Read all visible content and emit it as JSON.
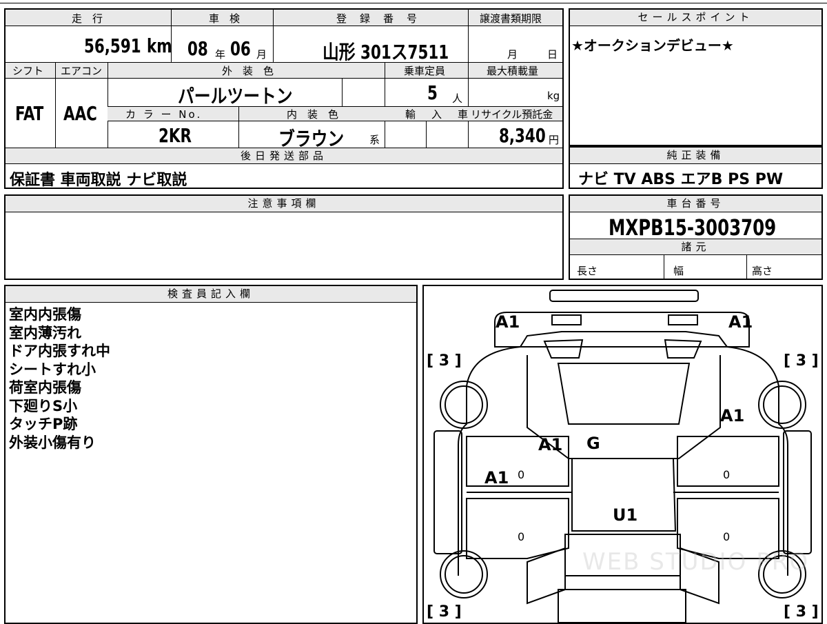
{
  "vehicle": {
    "mileage_label": "走　行",
    "mileage": "56,591",
    "mileage_unit": "km",
    "shaken_label": "車　検",
    "shaken_year": "08",
    "shaken_year_unit": "年",
    "shaken_month": "06",
    "shaken_month_unit": "月",
    "reg_label": "登　録　番　号",
    "reg_number": "山形 301ス7511",
    "transfer_label": "譲渡書類期限",
    "transfer_month_unit": "月",
    "transfer_day_unit": "日",
    "shift_label": "シフト",
    "shift": "FAT",
    "ac_label": "エアコン",
    "ac": "AAC",
    "ext_color_label": "外　装　色",
    "ext_color": "パールツートン",
    "capacity_label": "乗車定員",
    "capacity": "5",
    "capacity_unit": "人",
    "max_load_label": "最大積載量",
    "max_load_unit": "kg",
    "color_no_label": "カ ラ ー No.",
    "color_no": "2KR",
    "int_color_label": "内　装　色",
    "int_color": "ブラウン",
    "int_color_unit": "系",
    "import_label": "輸　入　車",
    "recycle_label": "リサイクル預託金",
    "recycle_fee": "8,340",
    "recycle_unit": "円"
  },
  "sales_point": {
    "label": "セールスポイント",
    "text": "★オークションデビュー★"
  },
  "later_parts": {
    "label": "後日発送部品",
    "text": "保証書 車両取説 ナビ取説"
  },
  "genuine_equipment": {
    "label": "純正装備",
    "text": "ナビ TV ABS エアB PS PW"
  },
  "notes": {
    "label": "注意事項欄",
    "text": ""
  },
  "chassis": {
    "label": "車台番号",
    "number": "MXPB15-3003709",
    "specs_label": "諸元",
    "length_label": "長さ",
    "width_label": "幅",
    "height_label": "高さ"
  },
  "inspector": {
    "label": "検査員記入欄",
    "lines": [
      "室内内張傷",
      "室内薄汚れ",
      "ドア内張すれ中",
      "シートすれ小",
      "荷室内張傷",
      "下廻りS小",
      "タッチP跡",
      "外装小傷有り"
    ]
  },
  "diagram": {
    "marks": [
      "A1",
      "A1",
      "A1",
      "A1",
      "A1",
      "G",
      "U1"
    ],
    "tire_marks": [
      "[ 3 ]",
      "[ 3 ]",
      "[ 3 ]",
      "[ 3 ]"
    ],
    "zeros": [
      "0",
      "0",
      "0",
      "0"
    ],
    "watermark": "WEB STUDIO PRO"
  }
}
